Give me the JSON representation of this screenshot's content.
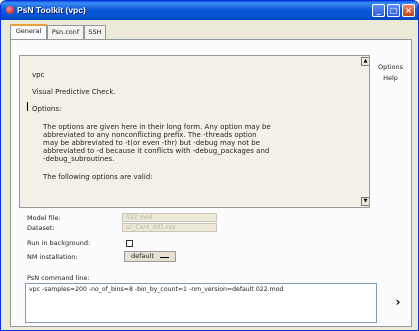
{
  "window": {
    "title": "PsN Toolkit (vpc)"
  },
  "tabs": [
    {
      "label": "General"
    },
    {
      "label": "Psn.conf"
    },
    {
      "label": "SSH"
    }
  ],
  "help": {
    "text": {
      "command": "vpc",
      "description": "Visual Predictive Check.",
      "options_heading": "Options:",
      "options_body": "The options are given here in their long form. Any option may be\nabbreviated to any nonconflicting prefix. The -threads option\nmay be abbreviated to -t(or even -thr) but -debug may not be\nabbreviated to -d because it conflicts with -debug_packages and\n-debug_subroutines.",
      "valid_intro": "The following options are valid:"
    },
    "side_buttons": {
      "options": "Options",
      "help": "Help"
    }
  },
  "form": {
    "model_file": {
      "label": "Model file:",
      "value": "022.mod"
    },
    "dataset": {
      "label": "Dataset:",
      "value": "sc_Cont_001.csv"
    },
    "run_background": {
      "label": "Run in background:",
      "checked": false
    },
    "nm_installation": {
      "label": "NM installation:",
      "value": "default"
    }
  },
  "command": {
    "label": "PsN command line:",
    "value": "vpc -samples=200 -no_of_bins=8 -bin_by_count=1 -nm_version=default 022.mod"
  },
  "icons": {
    "run": "chevron-right-icon",
    "scroll_up": "arrow-up-icon",
    "scroll_down": "arrow-down-icon"
  }
}
